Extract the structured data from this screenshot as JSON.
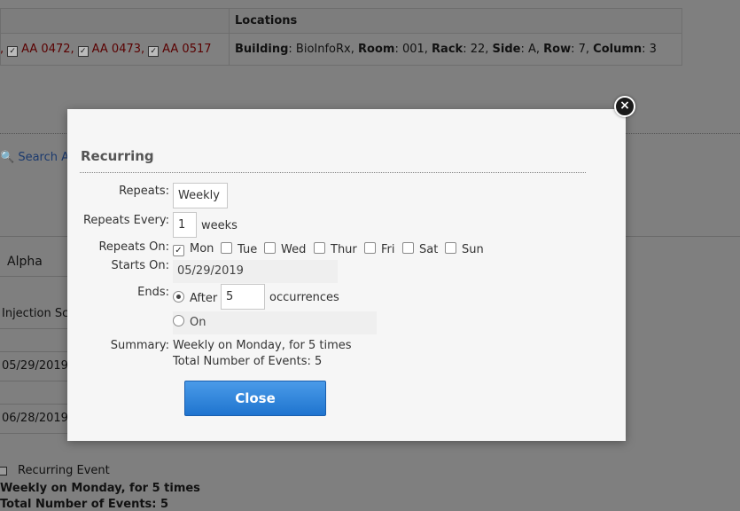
{
  "background": {
    "table": {
      "locations_header": "Locations",
      "ids": [
        "AA 0472,",
        "AA 0473,",
        "AA 0517"
      ],
      "location": {
        "building_label": "Building",
        "building_value": "BioInfoRx",
        "room_label": "Room",
        "room_value": "001",
        "rack_label": "Rack",
        "rack_value": "22",
        "side_label": "Side",
        "side_value": "A",
        "row_label": "Row",
        "row_value": "7",
        "column_label": "Column",
        "column_value": "3"
      }
    },
    "search_link": "Search A",
    "fields": {
      "group_value": "Alpha",
      "type_value": "Injection Sc",
      "start_date": "05/29/2019",
      "end_date": "06/28/2019"
    },
    "recurring_event_label": "Recurring Event",
    "recurring_summary": "Weekly on Monday, for 5 times",
    "recurring_total": "Total Number of Events: 5"
  },
  "modal": {
    "close_icon_glyph": "×",
    "title": "Recurring",
    "repeats": {
      "label": "Repeats:",
      "value": "Weekly"
    },
    "repeats_every": {
      "label": "Repeats Every:",
      "value": "1",
      "unit": "weeks"
    },
    "repeats_on": {
      "label": "Repeats On:",
      "days": [
        {
          "label": "Mon",
          "checked": true
        },
        {
          "label": "Tue",
          "checked": false
        },
        {
          "label": "Wed",
          "checked": false
        },
        {
          "label": "Thur",
          "checked": false
        },
        {
          "label": "Fri",
          "checked": false
        },
        {
          "label": "Sat",
          "checked": false
        },
        {
          "label": "Sun",
          "checked": false
        }
      ]
    },
    "starts_on": {
      "label": "Starts On:",
      "value": "05/29/2019"
    },
    "ends": {
      "label": "Ends:",
      "after_label": "After",
      "after_value": "5",
      "after_unit": "occurrences",
      "on_label": "On",
      "selected": "after"
    },
    "summary": {
      "label": "Summary:",
      "text": "Weekly on Monday, for 5 times",
      "total": "Total Number of Events: 5"
    },
    "close_button": "Close"
  }
}
